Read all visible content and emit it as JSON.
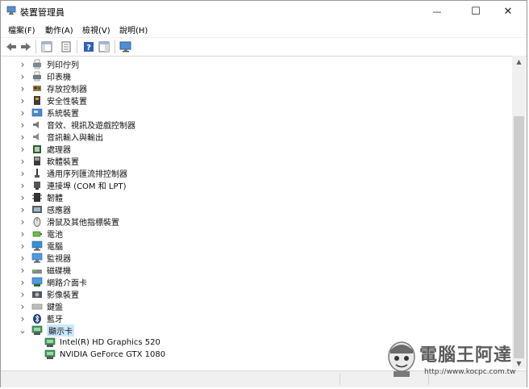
{
  "window": {
    "title": "裝置管理員",
    "minimize": "—",
    "maximize": "☐",
    "close": "✕"
  },
  "menu": [
    "檔案(F)",
    "動作(A)",
    "檢視(V)",
    "說明(H)"
  ],
  "tree": [
    {
      "label": "列印佇列",
      "icon": "printer-queue-icon"
    },
    {
      "label": "印表機",
      "icon": "printer-icon"
    },
    {
      "label": "存放控制器",
      "icon": "storage-controller-icon"
    },
    {
      "label": "安全性裝置",
      "icon": "security-device-icon"
    },
    {
      "label": "系統裝置",
      "icon": "system-device-icon"
    },
    {
      "label": "音效、視訊及遊戲控制器",
      "icon": "speaker-icon"
    },
    {
      "label": "音訊輸入與輸出",
      "icon": "audio-io-icon"
    },
    {
      "label": "處理器",
      "icon": "processor-icon"
    },
    {
      "label": "軟體裝置",
      "icon": "software-device-icon"
    },
    {
      "label": "通用序列匯流排控制器",
      "icon": "usb-icon"
    },
    {
      "label": "連接埠 (COM 和 LPT)",
      "icon": "port-icon"
    },
    {
      "label": "韌體",
      "icon": "firmware-icon"
    },
    {
      "label": "感應器",
      "icon": "sensor-icon"
    },
    {
      "label": "滑鼠及其他指標裝置",
      "icon": "mouse-icon"
    },
    {
      "label": "電池",
      "icon": "battery-icon"
    },
    {
      "label": "電腦",
      "icon": "computer-icon"
    },
    {
      "label": "監視器",
      "icon": "monitor-icon"
    },
    {
      "label": "磁碟機",
      "icon": "disk-drive-icon"
    },
    {
      "label": "網路介面卡",
      "icon": "network-adapter-icon"
    },
    {
      "label": "影像裝置",
      "icon": "imaging-device-icon"
    },
    {
      "label": "鍵盤",
      "icon": "keyboard-icon"
    },
    {
      "label": "藍牙",
      "icon": "bluetooth-icon"
    },
    {
      "label": "顯示卡",
      "icon": "display-adapter-icon",
      "expanded": true,
      "selected": true
    }
  ],
  "children": [
    {
      "label": "Intel(R) HD Graphics 520",
      "icon": "display-adapter-icon"
    },
    {
      "label": "NVIDIA GeForce GTX 1080",
      "icon": "display-adapter-icon"
    }
  ],
  "watermark": {
    "text": "電腦王阿達",
    "url": "http://www.kocpc.com.tw"
  },
  "colors": {
    "selection": "#cce8ff",
    "accent": "#1e5fa8"
  }
}
